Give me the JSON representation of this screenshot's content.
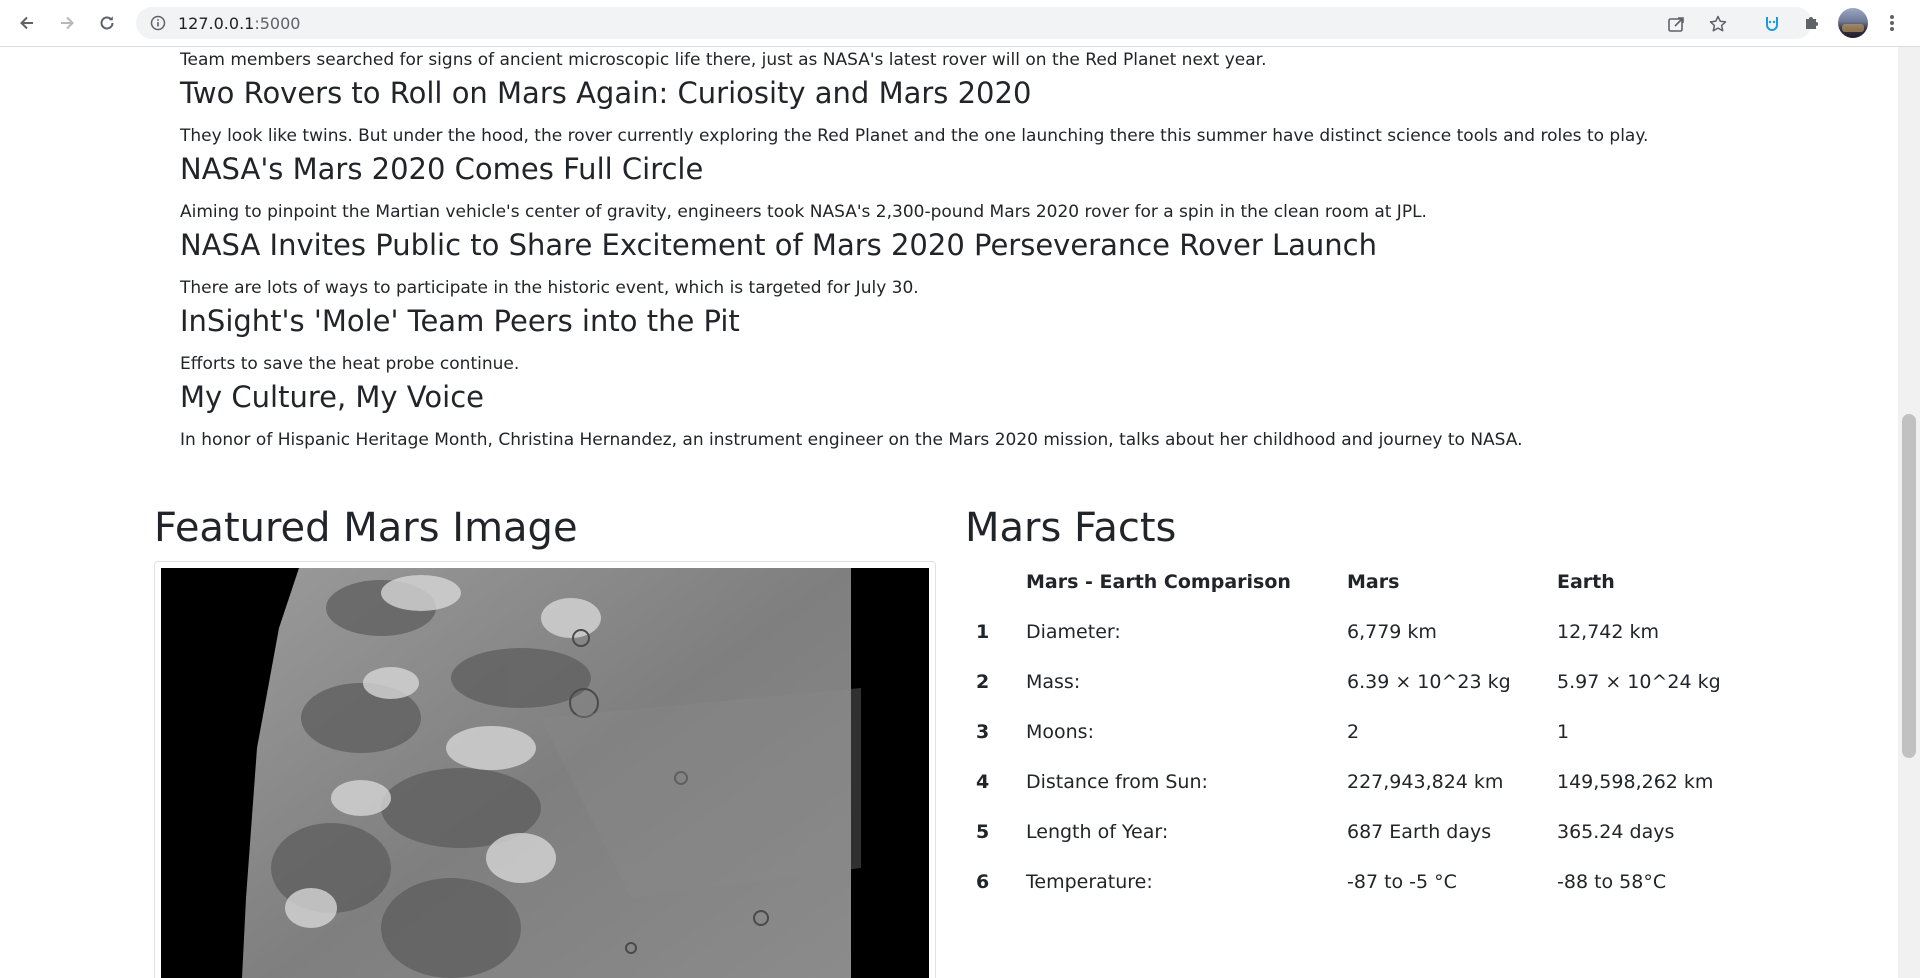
{
  "browser": {
    "url_host": "127.0.0.1",
    "url_port": ":5000"
  },
  "news": [
    {
      "title": "",
      "teaser": "Team members searched for signs of ancient microscopic life there, just as NASA's latest rover will on the Red Planet next year."
    },
    {
      "title": "Two Rovers to Roll on Mars Again: Curiosity and Mars 2020",
      "teaser": "They look like twins. But under the hood, the rover currently exploring the Red Planet and the one launching there this summer have distinct science tools and roles to play."
    },
    {
      "title": "NASA's Mars 2020 Comes Full Circle",
      "teaser": "Aiming to pinpoint the Martian vehicle's center of gravity, engineers took NASA's 2,300-pound Mars 2020 rover for a spin in the clean room at JPL."
    },
    {
      "title": "NASA Invites Public to Share Excitement of Mars 2020 Perseverance Rover Launch",
      "teaser": "There are lots of ways to participate in the historic event, which is targeted for July 30."
    },
    {
      "title": "InSight's 'Mole' Team Peers into the Pit",
      "teaser": "Efforts to save the heat probe continue."
    },
    {
      "title": "My Culture, My Voice",
      "teaser": "In honor of Hispanic Heritage Month, Christina Hernandez, an instrument engineer on the Mars 2020 mission, talks about her childhood and journey to NASA."
    }
  ],
  "featured": {
    "heading": "Featured Mars Image"
  },
  "facts": {
    "heading": "Mars Facts",
    "headers": [
      "",
      "Mars - Earth Comparison",
      "Mars",
      "Earth"
    ],
    "rows": [
      [
        "1",
        "Diameter:",
        "6,779 km",
        "12,742 km"
      ],
      [
        "2",
        "Mass:",
        "6.39 × 10^23 kg",
        "5.97 × 10^24 kg"
      ],
      [
        "3",
        "Moons:",
        "2",
        "1"
      ],
      [
        "4",
        "Distance from Sun:",
        "227,943,824 km",
        "149,598,262 km"
      ],
      [
        "5",
        "Length of Year:",
        "687 Earth days",
        "365.24 days"
      ],
      [
        "6",
        "Temperature:",
        "-87 to -5 °C",
        "-88 to 58°C"
      ]
    ]
  }
}
